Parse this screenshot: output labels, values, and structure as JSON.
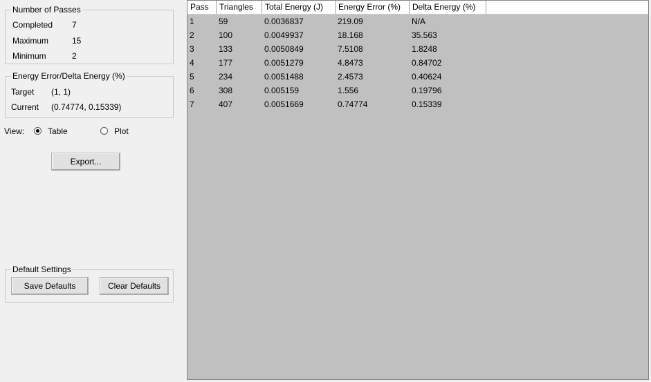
{
  "passes": {
    "title": "Number of Passes",
    "completed_label": "Completed",
    "completed_value": "7",
    "maximum_label": "Maximum",
    "maximum_value": "15",
    "minimum_label": "Minimum",
    "minimum_value": "2"
  },
  "energy": {
    "title": "Energy Error/Delta Energy (%)",
    "target_label": "Target",
    "target_value": "(1, 1)",
    "current_label": "Current",
    "current_value": "(0.74774, 0.15339)"
  },
  "view": {
    "label": "View:",
    "options": [
      {
        "label": "Table",
        "selected": true
      },
      {
        "label": "Plot",
        "selected": false
      }
    ]
  },
  "export_label": "Export...",
  "defaults": {
    "title": "Default Settings",
    "save_label": "Save Defaults",
    "clear_label": "Clear Defaults"
  },
  "table": {
    "columns": [
      "Pass",
      "Triangles",
      "Total Energy (J)",
      "Energy Error (%)",
      "Delta Energy (%)"
    ],
    "rows": [
      [
        "1",
        "59",
        "0.0036837",
        "219.09",
        "N/A"
      ],
      [
        "2",
        "100",
        "0.0049937",
        "18.168",
        "35.563"
      ],
      [
        "3",
        "133",
        "0.0050849",
        "7.5108",
        "1.8248"
      ],
      [
        "4",
        "177",
        "0.0051279",
        "4.8473",
        "0.84702"
      ],
      [
        "5",
        "234",
        "0.0051488",
        "2.4573",
        "0.40624"
      ],
      [
        "6",
        "308",
        "0.005159",
        "1.556",
        "0.19796"
      ],
      [
        "7",
        "407",
        "0.0051669",
        "0.74774",
        "0.15339"
      ]
    ]
  }
}
